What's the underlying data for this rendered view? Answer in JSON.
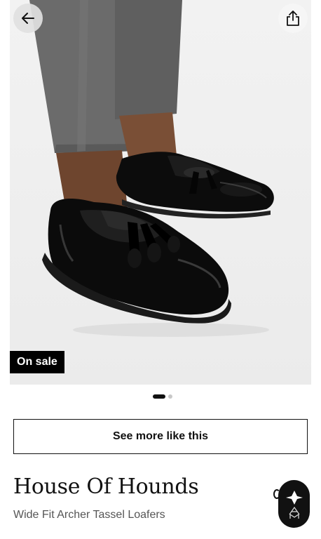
{
  "topbar": {
    "back_icon": "arrow-left-icon",
    "share_icon": "share-icon"
  },
  "gallery": {
    "badge": "On sale",
    "image_subject": "black-tassel-loafers-photo",
    "slide_count": 2,
    "active_slide": 1
  },
  "actions": {
    "see_more_label": "See more like this"
  },
  "product": {
    "brand": "House Of Hounds",
    "name": "Wide Fit Archer Tassel Loafers"
  },
  "assistant": {
    "icon": "style-assistant-icon"
  },
  "colors": {
    "badge_bg": "#000000",
    "badge_text": "#ffffff",
    "text_primary": "#111111",
    "text_secondary": "#555555"
  }
}
